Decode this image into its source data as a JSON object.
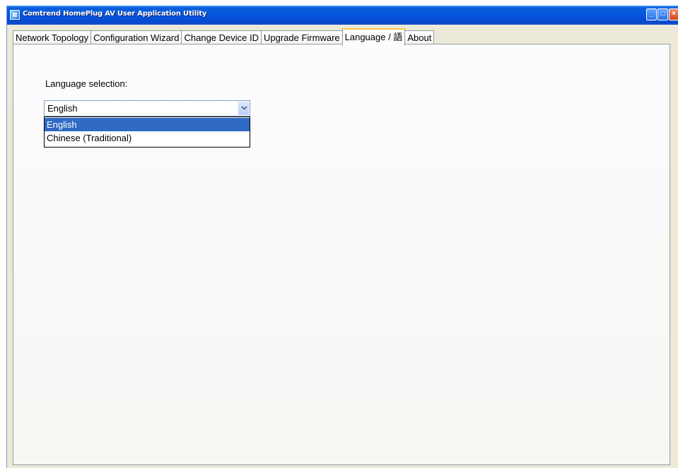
{
  "window": {
    "title": "Comtrend HomePlug AV User Application Utility",
    "controls": {
      "minimize": "_",
      "maximize": "□",
      "close": "×"
    }
  },
  "tabs": [
    {
      "label": "Network Topology",
      "active": false
    },
    {
      "label": "Configuration Wizard",
      "active": false
    },
    {
      "label": "Change Device ID",
      "active": false
    },
    {
      "label": "Upgrade Firmware",
      "active": false
    },
    {
      "label": "Language / 語",
      "active": true
    },
    {
      "label": "About",
      "active": false
    }
  ],
  "language": {
    "label": "Language selection:",
    "selected": "English",
    "options": [
      "English",
      "Chinese (Traditional)"
    ],
    "highlighted_option": "English"
  },
  "colors": {
    "titlebar": "#0554e0",
    "selection_highlight": "#316ac5",
    "active_tab_accent": "#ffc73c"
  },
  "icons": {
    "app": "app-icon",
    "dropdown": "chevron-down-icon"
  }
}
